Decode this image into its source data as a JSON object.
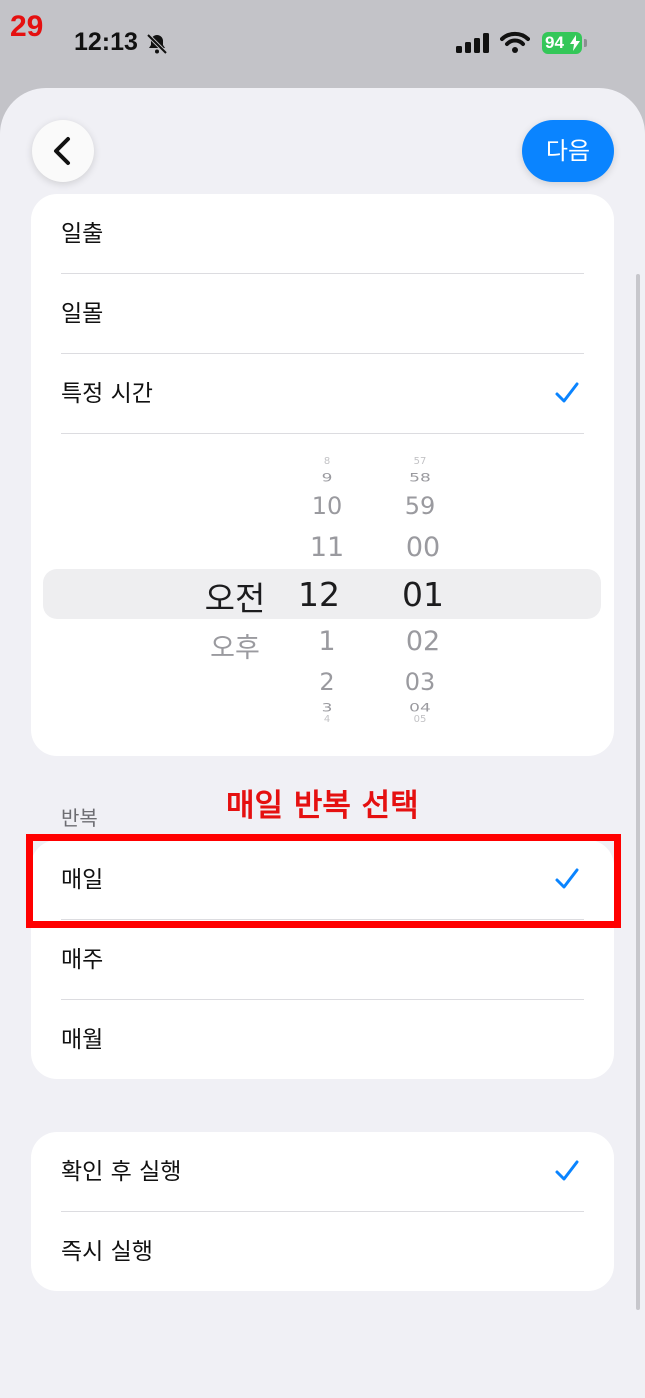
{
  "step_number": "29",
  "status_bar": {
    "time": "12:13",
    "battery": "94"
  },
  "nav": {
    "next_label": "다음"
  },
  "time_options": [
    {
      "label": "일출",
      "checked": false
    },
    {
      "label": "일몰",
      "checked": false
    },
    {
      "label": "특정 시간",
      "checked": true
    }
  ],
  "time_picker": {
    "period_column": [
      "오전",
      "오후"
    ],
    "period_selected": "오전",
    "hour_column": [
      "8",
      "9",
      "10",
      "11",
      "12",
      "1",
      "2",
      "3",
      "4"
    ],
    "hour_selected": "12",
    "minute_column": [
      "57",
      "58",
      "59",
      "00",
      "01",
      "02",
      "03",
      "04",
      "05"
    ],
    "minute_selected": "01"
  },
  "repeat_section": {
    "header": "반복",
    "options": [
      {
        "label": "매일",
        "checked": true
      },
      {
        "label": "매주",
        "checked": false
      },
      {
        "label": "매월",
        "checked": false
      }
    ]
  },
  "annotation": {
    "text": "매일 반복 선택",
    "color": "#e51010"
  },
  "run_options": [
    {
      "label": "확인 후 실행",
      "checked": true
    },
    {
      "label": "즉시 실행",
      "checked": false
    }
  ],
  "colors": {
    "accent": "#0a84ff",
    "annotation_red": "#ff0000"
  }
}
